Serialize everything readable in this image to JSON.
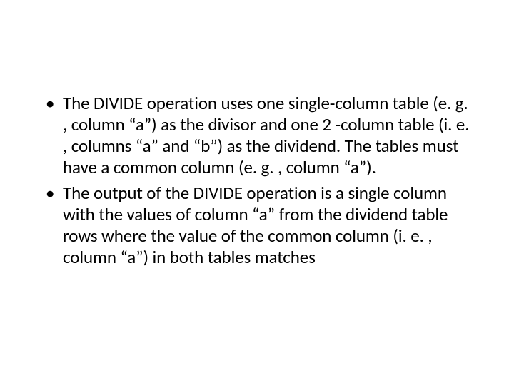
{
  "bullets": [
    "The DIVIDE operation uses one single-column table (e. g. , column “a”) as the divisor and one 2 -column table (i. e. , columns “a” and “b”) as the dividend. The tables must have a common column (e. g. , column “a”).",
    "The output of the DIVIDE operation is a single column with the values of column “a” from the dividend table rows where the value of the common column (i. e. , column “a”) in both tables matches"
  ]
}
